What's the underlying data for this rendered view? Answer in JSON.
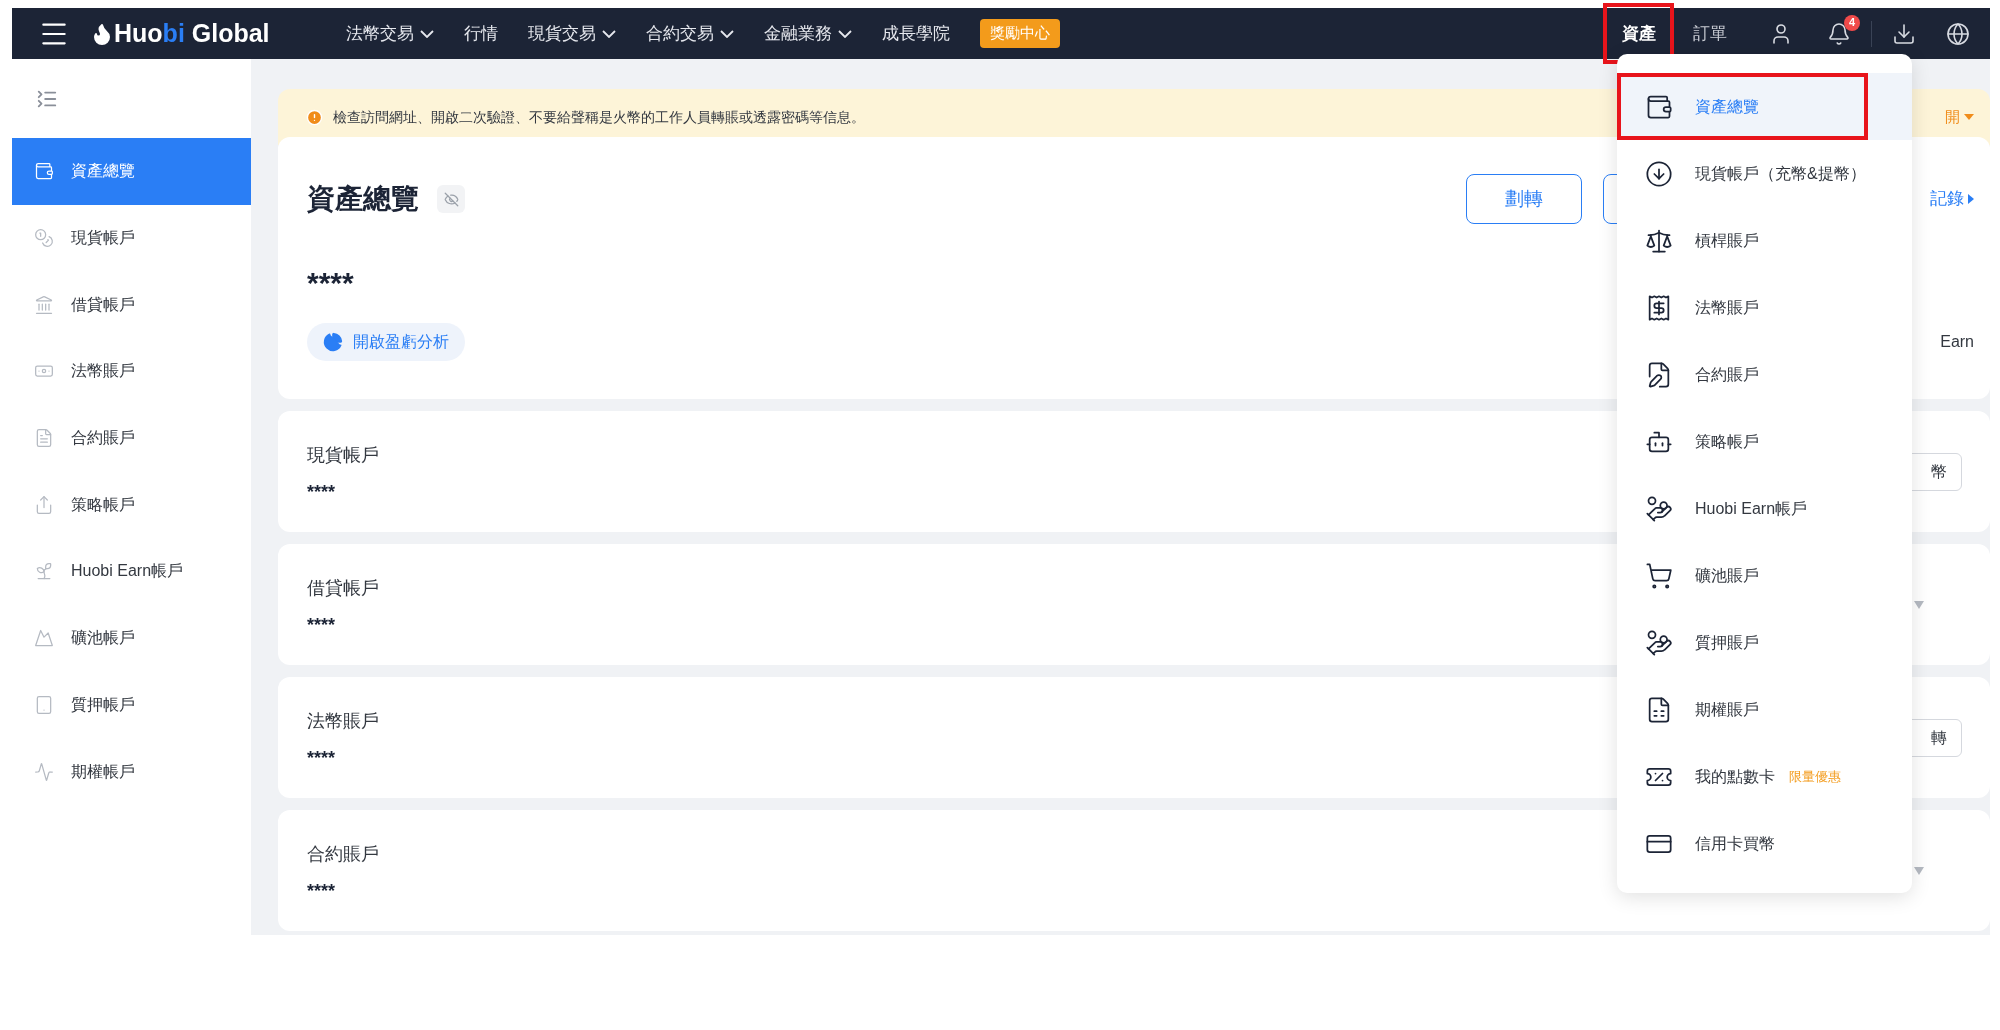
{
  "top_bar": {
    "logo": [
      {
        "text": "Huo",
        "accent": false
      },
      {
        "text": "bi",
        "accent": true
      },
      {
        "text": " Global",
        "accent": false
      }
    ],
    "nav": [
      {
        "label": "法幣交易",
        "kind": "menu"
      },
      {
        "label": "行情",
        "kind": "link"
      },
      {
        "label": "現貨交易",
        "kind": "menu"
      },
      {
        "label": "合約交易",
        "kind": "menu"
      },
      {
        "label": "金融業務",
        "kind": "menu"
      },
      {
        "label": "成長學院",
        "kind": "link"
      },
      {
        "label": "獎勵中心",
        "kind": "badge"
      }
    ],
    "right_nav": [
      {
        "label": "資產",
        "selected": true,
        "highlighted": true
      },
      {
        "label": "訂單",
        "selected": false,
        "highlighted": false
      }
    ],
    "notification_count": "4"
  },
  "sidebar": {
    "items": [
      {
        "label": "資產總覽",
        "selected": true
      },
      {
        "label": "現貨帳戶",
        "selected": false
      },
      {
        "label": "借貸帳戶",
        "selected": false
      },
      {
        "label": "法幣賬戶",
        "selected": false
      },
      {
        "label": "合約賬戶",
        "selected": false
      },
      {
        "label": "策略帳戶",
        "selected": false
      },
      {
        "label": "Huobi Earn帳戶",
        "selected": false
      },
      {
        "label": "礦池帳戶",
        "selected": false
      },
      {
        "label": "質押帳戶",
        "selected": false
      },
      {
        "label": "期權帳戶",
        "selected": false
      }
    ]
  },
  "notice": {
    "text": "檢查訪問網址、開啟二次驗證、不要給聲稱是火幣的工作人員轉賬或透露密碼等信息。",
    "expand_label": "開"
  },
  "overview": {
    "title": "資產總覽",
    "balance": "****",
    "transfer_button": "劃轉",
    "history_link": "記錄",
    "analysis_button": "開啟盈虧分析",
    "earn_label": "Earn"
  },
  "accounts": [
    {
      "name": "現貨帳戶",
      "balance": "****",
      "kind": "button",
      "action": "幣"
    },
    {
      "name": "借貸帳戶",
      "balance": "****",
      "kind": "caret"
    },
    {
      "name": "法幣賬戶",
      "balance": "****",
      "kind": "button",
      "action": "轉"
    },
    {
      "name": "合約賬戶",
      "balance": "****",
      "kind": "caret"
    }
  ],
  "assets_menu": {
    "items": [
      {
        "label": "資產總覽",
        "selected": true,
        "highlighted": true
      },
      {
        "label": "現貨帳戶（充幣&提幣）",
        "selected": false,
        "highlighted": false
      },
      {
        "label": "槓桿賬戶",
        "selected": false,
        "highlighted": false
      },
      {
        "label": "法幣賬戶",
        "selected": false,
        "highlighted": false
      },
      {
        "label": "合約賬戶",
        "selected": false,
        "highlighted": false
      },
      {
        "label": "策略帳戶",
        "selected": false,
        "highlighted": false
      },
      {
        "label": "Huobi Earn帳戶",
        "selected": false,
        "highlighted": false
      },
      {
        "label": "礦池賬戶",
        "selected": false,
        "highlighted": false
      },
      {
        "label": "質押賬戶",
        "selected": false,
        "highlighted": false
      },
      {
        "label": "期權賬戶",
        "selected": false,
        "highlighted": false
      },
      {
        "label": "我的點數卡",
        "selected": false,
        "highlighted": false,
        "badge": "限量優惠"
      },
      {
        "label": "信用卡買幣",
        "selected": false,
        "highlighted": false
      }
    ]
  }
}
